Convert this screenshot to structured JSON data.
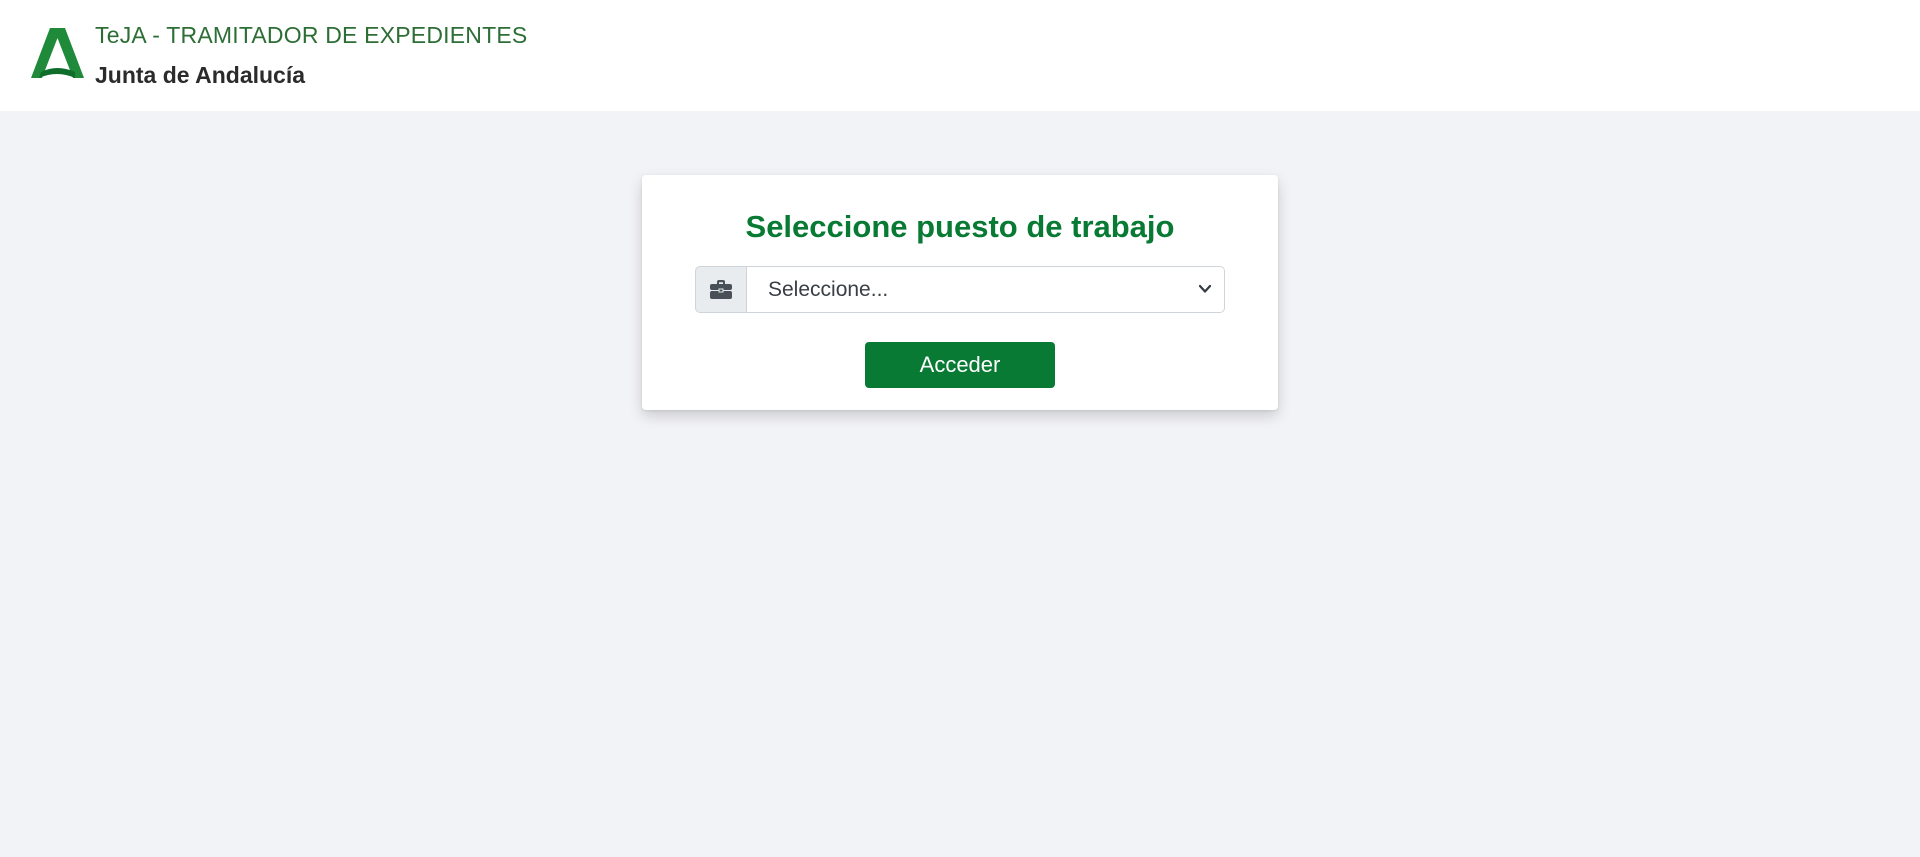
{
  "header": {
    "app_title": "TeJA - TRAMITADOR DE EXPEDIENTES",
    "org_name": "Junta de Andalucía",
    "logo_icon": "junta-andalucia-logo-icon",
    "brand_color": "#087a34"
  },
  "card": {
    "title": "Seleccione puesto de trabajo",
    "addon_icon": "briefcase-icon",
    "select": {
      "selected_value": "Seleccione..."
    },
    "submit_label": "Acceder"
  }
}
